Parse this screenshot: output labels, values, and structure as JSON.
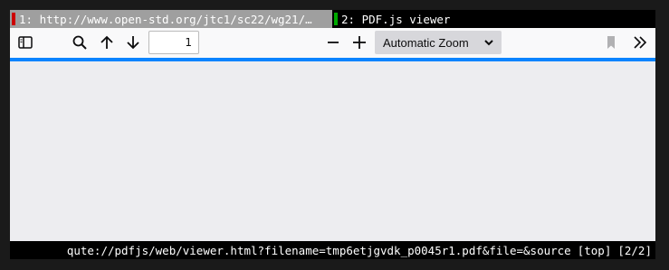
{
  "tabs": [
    {
      "index": "1:",
      "title": "http://www.open-std.org/jtc1/sc22/wg21/…",
      "indicator_color": "#cc0000",
      "selected": true
    },
    {
      "index": "2:",
      "title": "PDF.js viewer",
      "indicator_color": "#00aa00",
      "selected": false
    }
  ],
  "toolbar": {
    "sidebar_toggle_icon": "sidebar-icon",
    "search_icon": "search-icon",
    "prev_icon": "arrow-up-icon",
    "next_icon": "arrow-down-icon",
    "page_number": "1",
    "zoom_out_icon": "minus-icon",
    "zoom_in_icon": "plus-icon",
    "zoom_value": "Automatic Zoom",
    "bookmark_icon": "bookmark-icon",
    "more_tools_icon": "double-chevron-right-icon"
  },
  "colors": {
    "accent": "#0a84ff",
    "selected_tab_bg": "#9f9f9f"
  },
  "status": {
    "url": "qute://pdfjs/web/viewer.html?filename=tmp6etjgvdk_p0045r1.pdf&file=&source",
    "scroll": "[top]",
    "tab_position": "[2/2]"
  }
}
